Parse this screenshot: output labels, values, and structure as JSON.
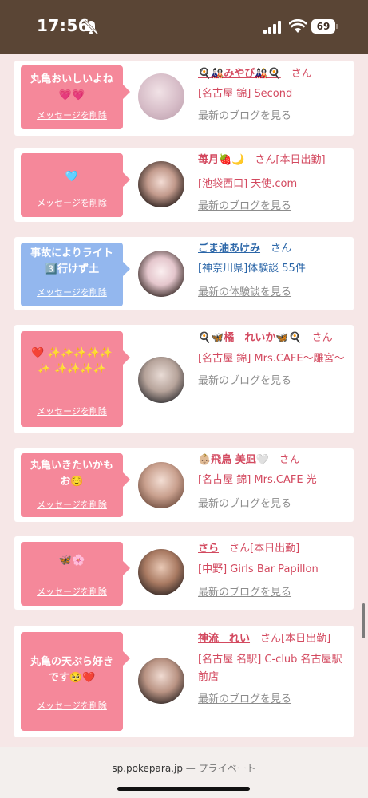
{
  "status": {
    "time": "17:56",
    "battery": "69"
  },
  "cards": [
    {
      "message": "丸亀おいしいよね💗💗",
      "bubble": "pink",
      "delete": "メッセージを削除",
      "name": "🍳🎎みやび🎎🍳",
      "name_color": "pink",
      "suffix": "さん",
      "shop": "[名古屋 錦] Second",
      "link": "最新のブログを見る"
    },
    {
      "message": "🩵",
      "bubble": "pink",
      "delete": "メッセージを削除",
      "name": "苺月🍓🌙",
      "name_color": "pink",
      "suffix": "さん[本日出勤]",
      "shop": "[池袋西口] 天使.com",
      "link": "最新のブログを見る"
    },
    {
      "message": "事故によりライト3️⃣行けず土",
      "bubble": "blue",
      "delete": "メッセージを削除",
      "name": "ごま油あけみ",
      "name_color": "blue",
      "suffix": "さん",
      "shop": "[神奈川県]体験談 55件",
      "link": "最新の体験談を見る"
    },
    {
      "message": "❤️ ✨✨✨✨✨✨ ✨✨✨✨",
      "bubble": "pink",
      "delete": "メッセージを削除",
      "name": "🍳🦋橘　れいか🦋🍳",
      "name_color": "pink",
      "suffix": "さん",
      "shop": "[名古屋 錦] Mrs.CAFE～雕宮～",
      "link": "最新のブログを見る"
    },
    {
      "message": "丸亀いきたいかもお☺️",
      "bubble": "pink",
      "delete": "メッセージを削除",
      "name": "👶🏼飛鳥 美凪🤍",
      "name_color": "pink",
      "suffix": "さん",
      "shop": "[名古屋 錦] Mrs.CAFE 光",
      "link": "最新のブログを見る"
    },
    {
      "message": "🦋🌸",
      "bubble": "pink",
      "delete": "メッセージを削除",
      "name": "さら",
      "name_color": "pink",
      "suffix": "さん[本日出勤]",
      "shop": "[中野] Girls Bar Papillon",
      "link": "最新のブログを見る"
    },
    {
      "message": "丸亀の天ぷら好きです🥺❤️",
      "bubble": "pink",
      "delete": "メッセージを削除",
      "name": "神流　れい",
      "name_color": "pink",
      "suffix": "さん[本日出勤]",
      "shop": "[名古屋 名駅] C-club 名古屋駅前店",
      "link": "最新のブログを見る"
    }
  ],
  "browser": {
    "domain": "sp.pokepara.jp",
    "label": "— プライベート"
  },
  "colors": {
    "bubble_pink": "#f5889a",
    "bubble_blue": "#93b7ee",
    "name_pink": "#d3495f",
    "name_blue": "#2b66a8",
    "status_bar": "#5a4535"
  }
}
